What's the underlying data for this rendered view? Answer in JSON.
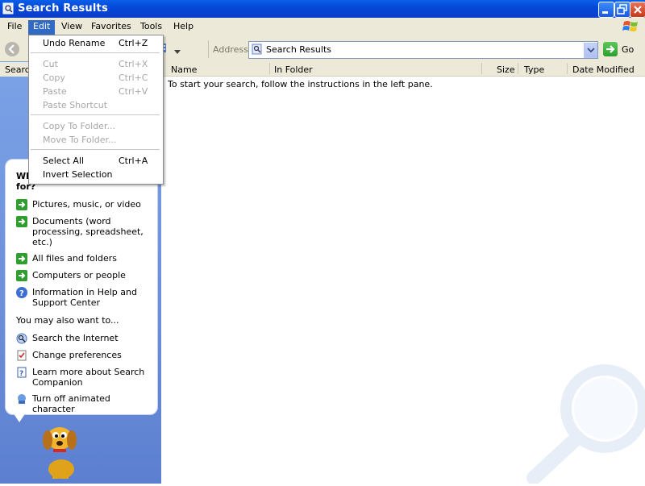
{
  "window": {
    "title": "Search Results"
  },
  "menubar": {
    "items": [
      "File",
      "Edit",
      "Favorites",
      "Tools",
      "Help"
    ]
  },
  "menubar_view": "View",
  "address": {
    "label": "Address",
    "value": "Search Results",
    "go_label": "Go"
  },
  "left_pane": {
    "header": "Search",
    "bubble_question": "Wh for?",
    "options": [
      "Pictures, music, or video",
      "Documents (word processing, spreadsheet, etc.)",
      "All files and folders",
      "Computers or people",
      "Information in Help and Support Center"
    ],
    "also_heading": "You may also want to...",
    "also_options": [
      "Search the Internet",
      "Change preferences",
      "Learn more about Search Companion",
      "Turn off animated character"
    ]
  },
  "results": {
    "columns": [
      "Name",
      "In Folder",
      "Size",
      "Type",
      "Date Modified"
    ],
    "hint": "To start your search, follow the instructions in the left pane."
  },
  "edit_menu": {
    "items": [
      {
        "label": "Undo Rename",
        "shortcut": "Ctrl+Z",
        "enabled": true
      },
      {
        "label": "Cut",
        "shortcut": "Ctrl+X",
        "enabled": false
      },
      {
        "label": "Copy",
        "shortcut": "Ctrl+C",
        "enabled": false
      },
      {
        "label": "Paste",
        "shortcut": "Ctrl+V",
        "enabled": false
      },
      {
        "label": "Paste Shortcut",
        "shortcut": "",
        "enabled": false
      },
      {
        "label": "Copy To Folder...",
        "shortcut": "",
        "enabled": false
      },
      {
        "label": "Move To Folder...",
        "shortcut": "",
        "enabled": false
      },
      {
        "label": "Select All",
        "shortcut": "Ctrl+A",
        "enabled": true
      },
      {
        "label": "Invert Selection",
        "shortcut": "",
        "enabled": true
      }
    ]
  },
  "colors": {
    "titlebar": "#0449d8",
    "menu_highlight": "#316ac5",
    "left_pane": "#6b8fd9",
    "disabled_text": "#a7a7a7"
  }
}
